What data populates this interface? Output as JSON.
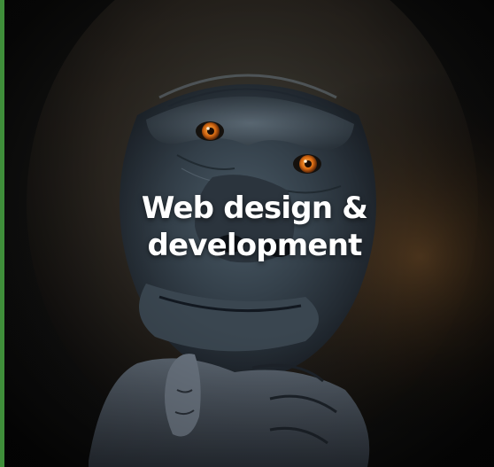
{
  "card": {
    "headline_line1": "Web design &",
    "headline_line2": "development",
    "image_subject": "gorilla-portrait-photo",
    "accent_color": "#3f8f3a",
    "text_color": "#ffffff"
  }
}
